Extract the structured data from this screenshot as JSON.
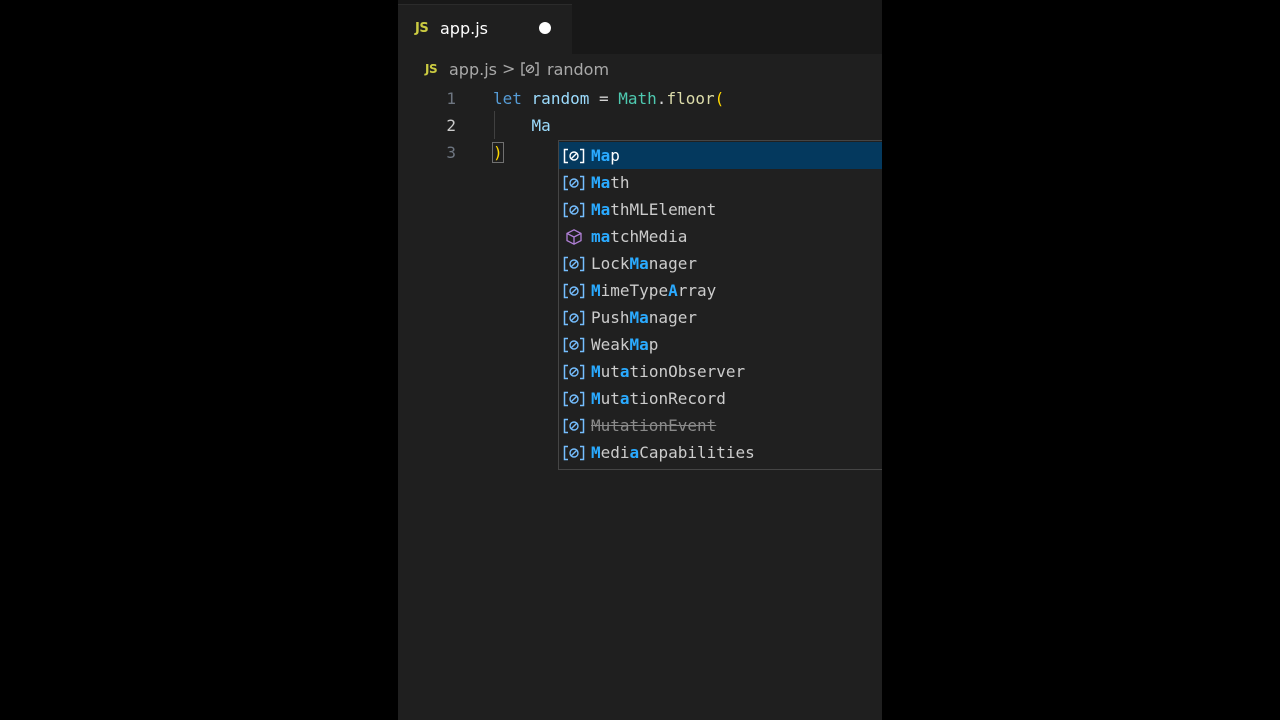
{
  "tab": {
    "icon_text": "JS",
    "label": "app.js"
  },
  "breadcrumb": {
    "icon_text": "JS",
    "file": "app.js",
    "separator": ">",
    "symbol": "random"
  },
  "code": {
    "line_numbers": [
      "1",
      "2",
      "3"
    ],
    "line1": {
      "keyword": "let",
      "variable": "random",
      "operator": "=",
      "object": "Math",
      "dot": ".",
      "method": "floor",
      "open_paren": "("
    },
    "line2": {
      "typed": "Ma"
    },
    "line3": {
      "close_paren": ")"
    }
  },
  "suggestions": [
    {
      "pre": "",
      "match": "Ma",
      "post": "p",
      "icon": "variable-icon"
    },
    {
      "pre": "",
      "match": "Ma",
      "post": "th",
      "icon": "variable-icon"
    },
    {
      "pre": "",
      "match": "Ma",
      "post": "thMLElement",
      "icon": "variable-icon"
    },
    {
      "pre": "",
      "match": "ma",
      "post": "tchMedia",
      "icon": "method-cube-icon"
    },
    {
      "pre": "Lock",
      "match": "Ma",
      "post": "nager",
      "icon": "variable-icon"
    },
    {
      "pre": "",
      "match": "M",
      "post": "imeType",
      "match2": "A",
      "post2": "rray",
      "icon": "variable-icon"
    },
    {
      "pre": "Push",
      "match": "Ma",
      "post": "nager",
      "icon": "variable-icon"
    },
    {
      "pre": "Weak",
      "match": "Ma",
      "post": "p",
      "icon": "variable-icon"
    },
    {
      "pre": "",
      "match": "M",
      "post": "ut",
      "match2": "a",
      "post2": "tionObserver",
      "icon": "variable-icon"
    },
    {
      "pre": "",
      "match": "M",
      "post": "ut",
      "match2": "a",
      "post2": "tionRecord",
      "icon": "variable-icon"
    },
    {
      "pre": "",
      "match": "",
      "post": "MutationEvent",
      "icon": "variable-icon",
      "deprecated": true
    },
    {
      "pre": "",
      "match": "M",
      "post": "edi",
      "match2": "a",
      "post2": "Capabilities",
      "icon": "variable-icon"
    }
  ],
  "colors": {
    "selection": "#04395e",
    "match_highlight": "#2aaaff",
    "js_icon": "#cbcb41"
  }
}
